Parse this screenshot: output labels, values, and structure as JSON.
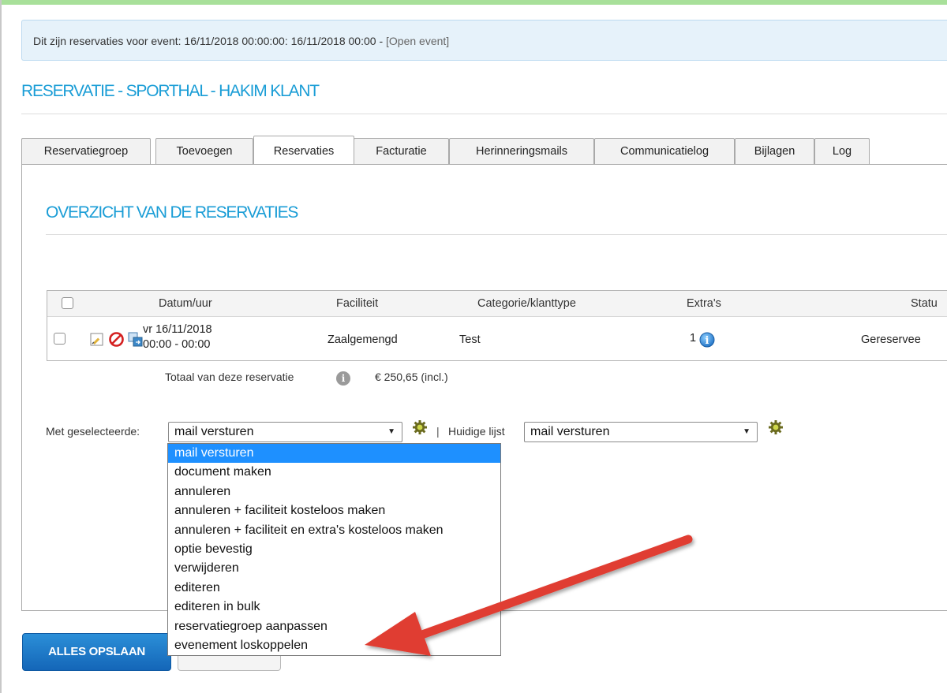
{
  "notice": {
    "text": "Dit zijn reservaties voor event: 16/11/2018 00:00:00: 16/11/2018 00:00 - ",
    "link": "[Open event]"
  },
  "page_title": "RESERVATIE - SPORTHAL - HAKIM KLANT",
  "tabs": [
    {
      "label": "Reservatiegroep",
      "active": false
    },
    {
      "label": "Toevoegen",
      "active": false
    },
    {
      "label": "Reservaties",
      "active": true
    },
    {
      "label": "Facturatie",
      "active": false
    },
    {
      "label": "Herinneringsmails",
      "active": false
    },
    {
      "label": "Communicatielog",
      "active": false
    },
    {
      "label": "Bijlagen",
      "active": false
    },
    {
      "label": "Log",
      "active": false
    }
  ],
  "section_title": "OVERZICHT VAN DE RESERVATIES",
  "table": {
    "headers": {
      "datum": "Datum/uur",
      "faciliteit": "Faciliteit",
      "categorie": "Categorie/klanttype",
      "extras": "Extra's",
      "status": "Statu"
    },
    "rows": [
      {
        "datum_line1": "vr 16/11/2018",
        "datum_line2": "00:00 - 00:00",
        "faciliteit": "Zaalgemengd",
        "categorie": "Test",
        "extras": "1",
        "status": "Gereservee"
      }
    ]
  },
  "total": {
    "label": "Totaal van deze reservatie",
    "value": "€ 250,65 (incl.)"
  },
  "bulk": {
    "met_label": "Met geselecteerde:",
    "met_selected": "mail versturen",
    "separator": "|",
    "huidige_label": "Huidige lijst",
    "huidige_selected": "mail versturen",
    "arrow_glyph": "▼"
  },
  "dropdown_options": [
    "mail versturen",
    "document maken",
    "annuleren",
    "annuleren + faciliteit kosteloos maken",
    "annuleren + faciliteit en extra's kosteloos maken",
    "optie bevestig",
    "verwijderen",
    "editeren",
    "editeren in bulk",
    "reservatiegroep aanpassen",
    "evenement loskoppelen"
  ],
  "dropdown_selected_index": 0,
  "buttons": {
    "save": "ALLES OPSLAAN"
  },
  "icons": {
    "edit": "edit-icon",
    "cancel": "cancel-icon",
    "move": "move-icon",
    "info": "info-icon",
    "gear": "gear-icon"
  },
  "colors": {
    "accent": "#1a9dd6",
    "selection": "#1e90ff",
    "annotation_arrow": "#e03c31"
  }
}
